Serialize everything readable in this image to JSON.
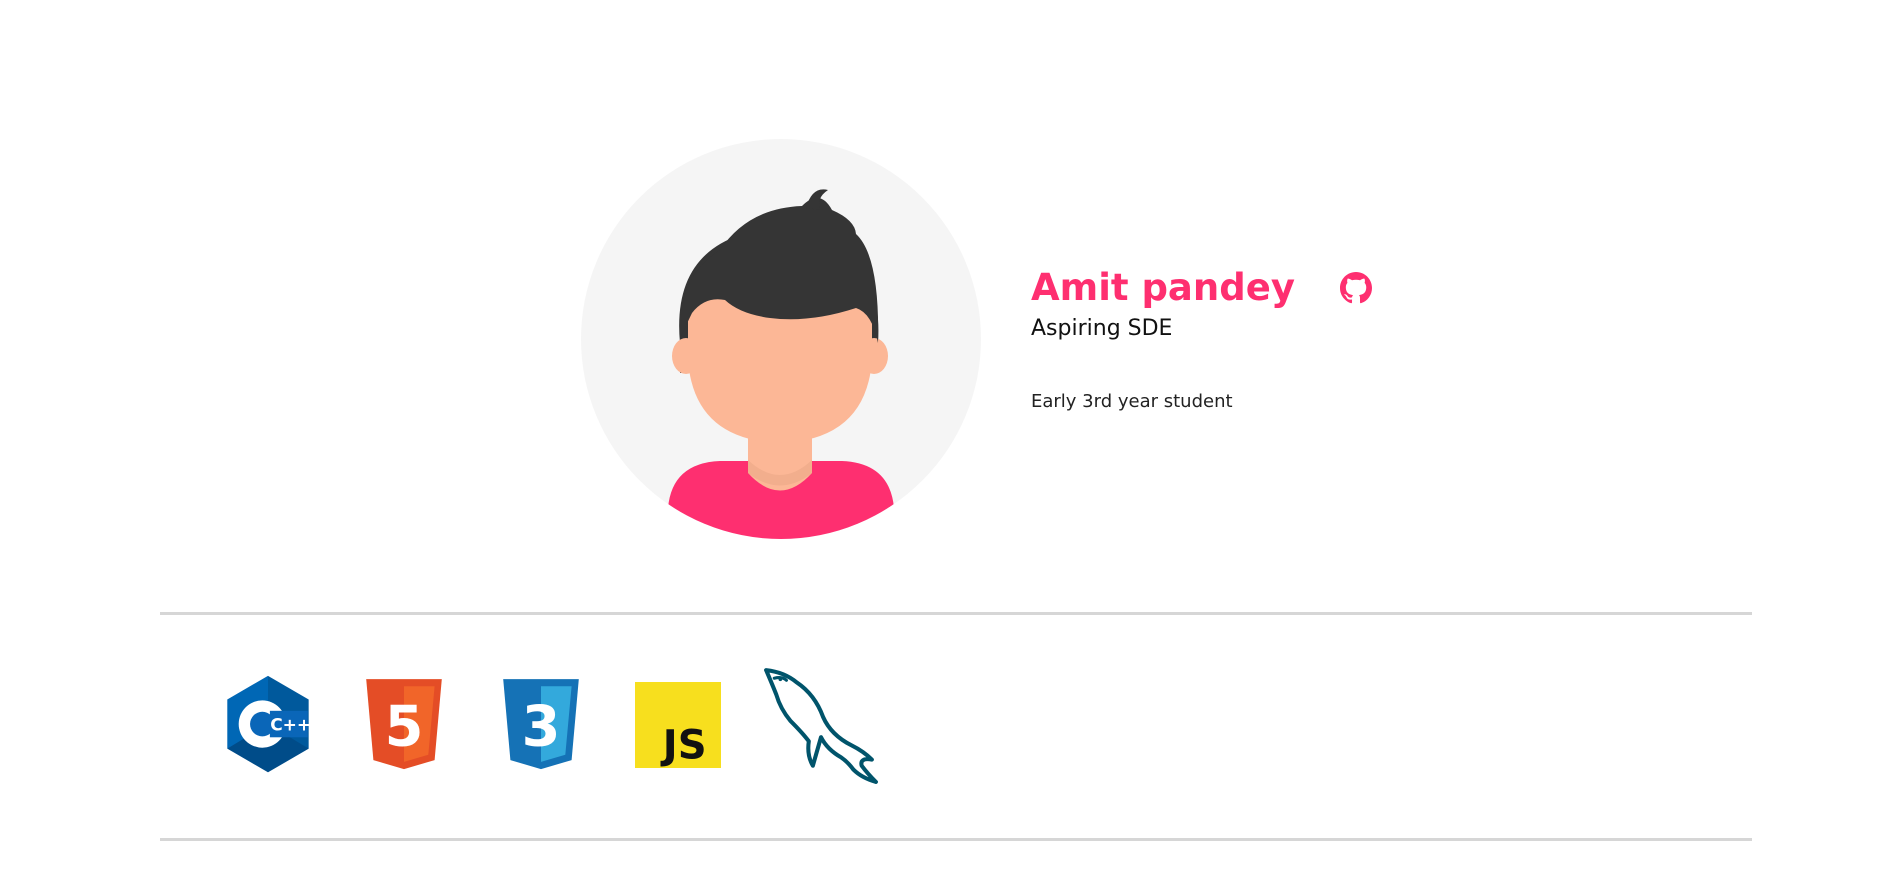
{
  "profile": {
    "name": "Amit pandey",
    "role": "Aspiring SDE",
    "bio": "Early 3rd year student",
    "github_icon": "github-icon",
    "avatar_icon": "avatar-illustration"
  },
  "colors": {
    "accent": "#fe2f70",
    "hair": "#353535",
    "skin": "#fcb796",
    "avatar_bg": "#f5f5f5",
    "divider": "#d6d6d6"
  },
  "skills": {
    "cpp": {
      "label": "C++",
      "icon": "cpp-icon"
    },
    "html": {
      "label": "5",
      "icon": "html5-icon"
    },
    "css": {
      "label": "3",
      "icon": "css3-icon"
    },
    "js": {
      "label": "JS",
      "icon": "javascript-icon"
    },
    "mysql": {
      "icon": "mysql-dolphin-icon"
    }
  }
}
